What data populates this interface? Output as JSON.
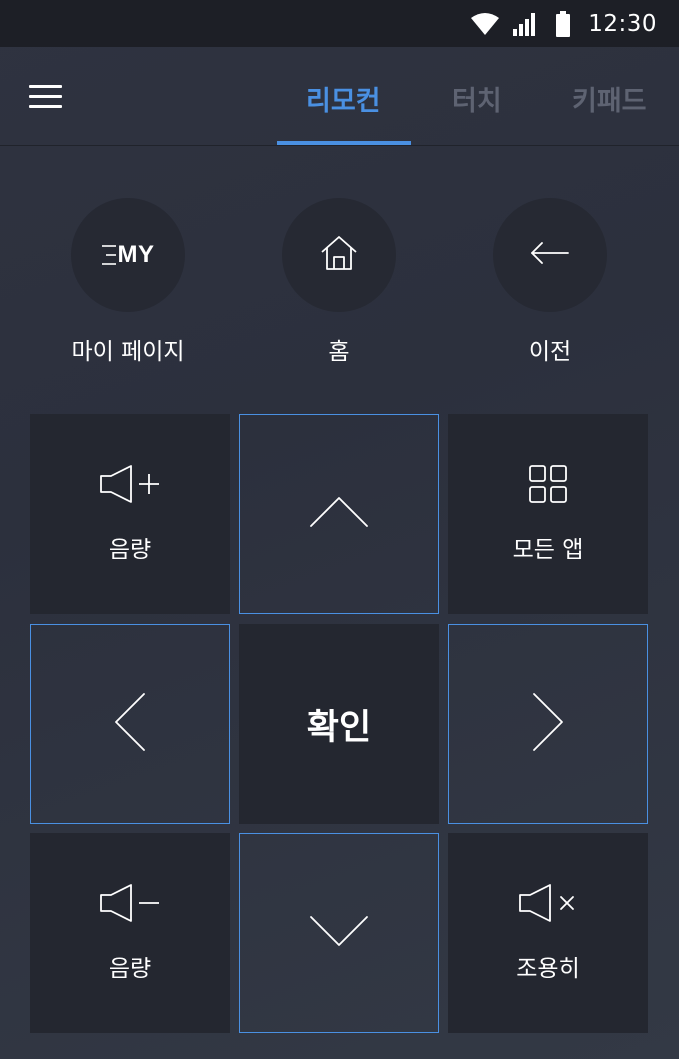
{
  "status_bar": {
    "time": "12:30",
    "icons": [
      "wifi-icon",
      "signal-icon",
      "battery-icon"
    ]
  },
  "header": {
    "menu_icon": "hamburger-menu-icon",
    "tabs": [
      {
        "label": "리모컨",
        "active": true
      },
      {
        "label": "터치",
        "active": false
      },
      {
        "label": "키패드",
        "active": false
      }
    ]
  },
  "quick_buttons": [
    {
      "label": "마이 페이지",
      "icon": "my-page-icon",
      "icon_text": "MY"
    },
    {
      "label": "홈",
      "icon": "home-icon"
    },
    {
      "label": "이전",
      "icon": "back-arrow-icon"
    }
  ],
  "grid": {
    "volume_up_label": "음량",
    "all_apps_label": "모든 앱",
    "ok_label": "확인",
    "volume_down_label": "음량",
    "mute_label": "조용히"
  },
  "colors": {
    "accent": "#4a90e2",
    "background": "#2f3340",
    "tile": "#242730",
    "status_bar": "#1d1f26",
    "inactive_tab": "#5e6372"
  }
}
